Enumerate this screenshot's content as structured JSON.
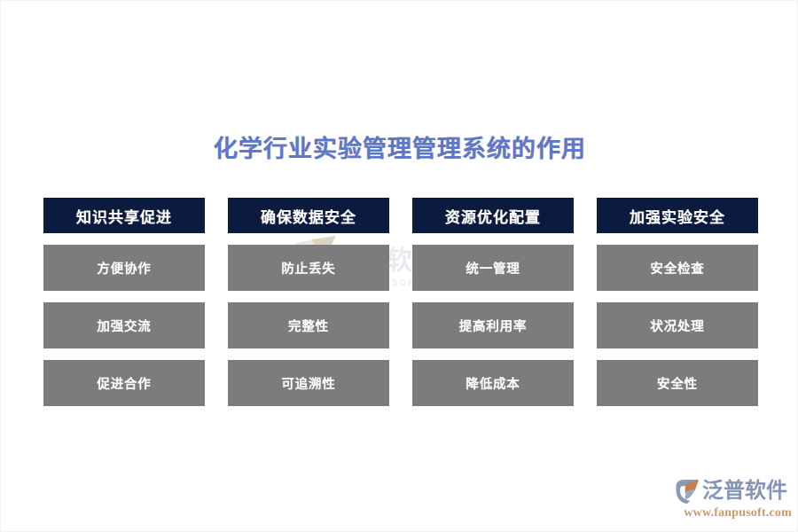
{
  "page": {
    "title": "化学行业实验管理管理系统的作用",
    "background_color": "#ffffff",
    "title_color": "#5b79c8",
    "header_color": "#0b1b3f",
    "cell_color": "#7c7c7c"
  },
  "columns": [
    {
      "header": "知识共享促进",
      "cells": [
        "方便协作",
        "加强交流",
        "促进合作"
      ]
    },
    {
      "header": "确保数据安全",
      "cells": [
        "防止丢失",
        "完整性",
        "可追溯性"
      ]
    },
    {
      "header": "资源优化配置",
      "cells": [
        "统一管理",
        "提高利用率",
        "降低成本"
      ]
    },
    {
      "header": "加强实验安全",
      "cells": [
        "安全检查",
        "状况处理",
        "安全性"
      ]
    }
  ],
  "watermark": {
    "text": "泛普软件",
    "subtext": "FANPU SOFTWARE"
  },
  "logo": {
    "mark_name": "fanpu-logo-mark",
    "wordmark": "泛普软件",
    "url": "www.fanpusoft.com",
    "wordmark_color": "#8494b8",
    "url_color": "#c99a68"
  }
}
